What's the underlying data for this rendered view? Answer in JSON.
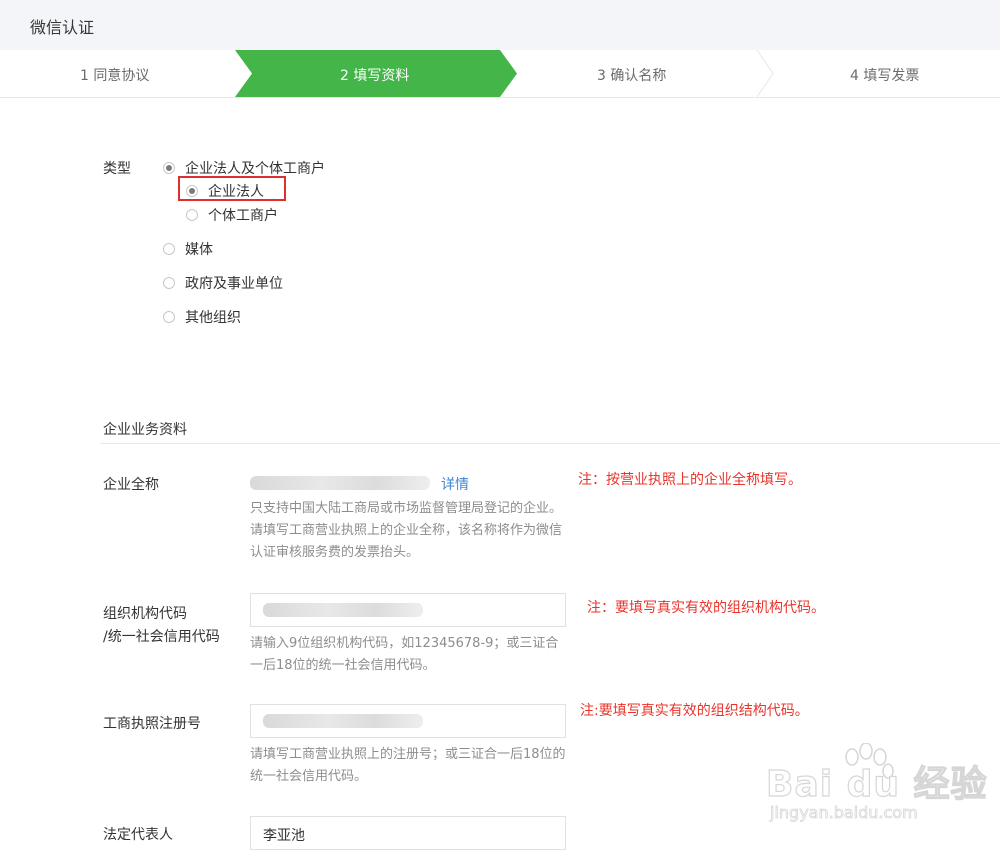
{
  "window": {
    "title": "微信认证"
  },
  "steps": [
    {
      "label": "1 同意协议",
      "active": false
    },
    {
      "label": "2 填写资料",
      "active": true
    },
    {
      "label": "3 确认名称",
      "active": false
    },
    {
      "label": "4 填写发票",
      "active": false
    }
  ],
  "colors": {
    "accent": "#44b549",
    "note": "#e8342b",
    "link": "#3d86d9",
    "highlight_border": "#e02e2e"
  },
  "type_section": {
    "label": "类型",
    "options": [
      {
        "label": "企业法人及个体工商户",
        "checked": true
      },
      {
        "label": "媒体",
        "checked": false
      },
      {
        "label": "政府及事业单位",
        "checked": false
      },
      {
        "label": "其他组织",
        "checked": false
      }
    ],
    "sub_options": [
      {
        "label": "企业法人",
        "checked": true
      },
      {
        "label": "个体工商户",
        "checked": false
      }
    ]
  },
  "business_section": {
    "title": "企业业务资料",
    "company_name": {
      "label": "企业全称",
      "link": "详情",
      "hint": "只支持中国大陆工商局或市场监督管理局登记的企业。请填写工商营业执照上的企业全称，该名称将作为微信认证审核服务费的发票抬头。",
      "note": "注：按营业执照上的企业全称填写。"
    },
    "org_code": {
      "label_line1": "组织机构代码",
      "label_line2": "/统一社会信用代码",
      "hint": "请输入9位组织机构代码，如12345678-9；或三证合一后18位的统一社会信用代码。",
      "note": "注：要填写真实有效的组织机构代码。"
    },
    "registration_no": {
      "label": "工商执照注册号",
      "hint": "请填写工商营业执照上的注册号；或三证合一后18位的统一社会信用代码。",
      "note": "注:要填写真实有效的组织结构代码。"
    },
    "legal_rep": {
      "label": "法定代表人",
      "value": "李亚池"
    }
  },
  "watermark": {
    "brand": "Bai du 经验",
    "url": "jingyan.baidu.com",
    "icon": "paw-icon"
  }
}
